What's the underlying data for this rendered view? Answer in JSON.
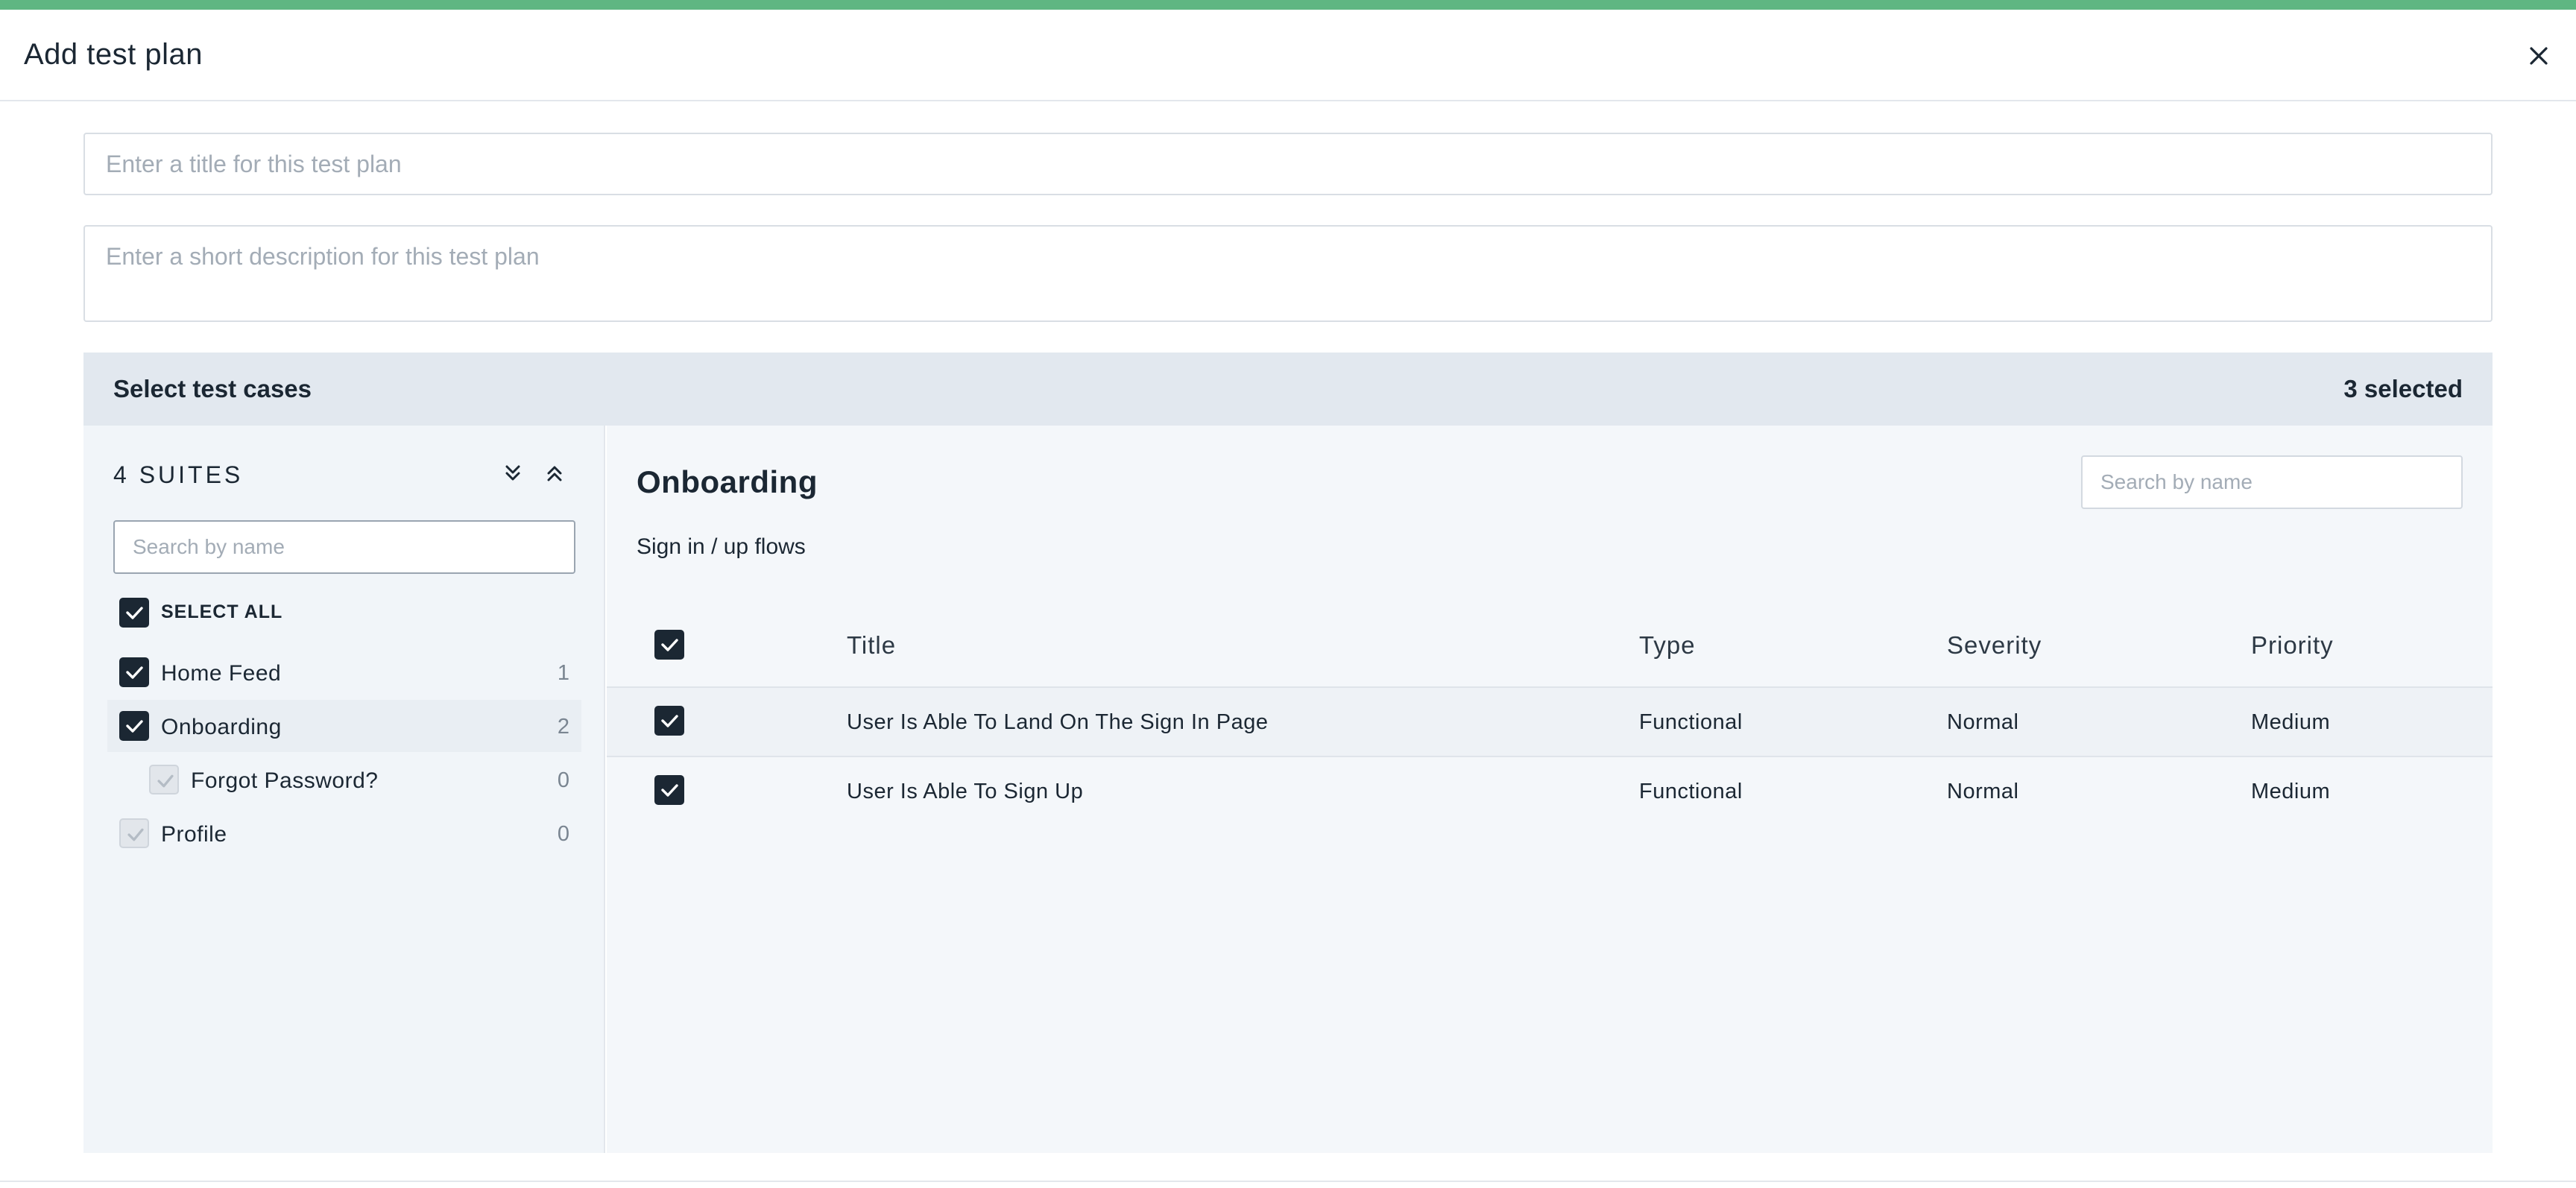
{
  "modal": {
    "title": "Add test plan"
  },
  "form": {
    "title_placeholder": "Enter a title for this test plan",
    "title_value": "",
    "description_placeholder": "Enter a short description for this test plan",
    "description_value": ""
  },
  "selection": {
    "header_label": "Select test cases",
    "selected_count": "3 selected"
  },
  "sidebar": {
    "suites_title": "4 SUITES",
    "search_placeholder": "Search by name",
    "select_all_label": "SELECT ALL",
    "suites": [
      {
        "label": "Home Feed",
        "count": "1",
        "checked": true
      },
      {
        "label": "Onboarding",
        "count": "2",
        "checked": true,
        "active": true
      },
      {
        "label": "Forgot Password?",
        "count": "0",
        "checked": false,
        "child": true
      },
      {
        "label": "Profile",
        "count": "0",
        "checked": false
      }
    ]
  },
  "main": {
    "suite_title": "Onboarding",
    "suite_description": "Sign in / up flows",
    "search_placeholder": "Search by name",
    "columns": [
      "Title",
      "Type",
      "Severity",
      "Priority"
    ],
    "rows": [
      {
        "title": "User Is Able To Land On The Sign In Page",
        "type": "Functional",
        "severity": "Normal",
        "priority": "Medium",
        "checked": true
      },
      {
        "title": "User Is Able To Sign Up",
        "type": "Functional",
        "severity": "Normal",
        "priority": "Medium",
        "checked": true
      }
    ]
  },
  "colors": {
    "accent": "#5fb682",
    "checkbox": "#1b2733",
    "panel_header": "#e2e8ef"
  }
}
